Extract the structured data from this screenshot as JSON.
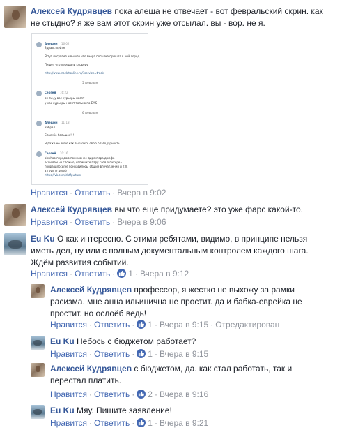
{
  "comments": [
    {
      "author": "Алексей Кудрявцев",
      "text_lines": [
        "пока алеша не отвечает - вот февральский скрин. как",
        "не стыдно? я же вам этот скрин уже отсылал. вы - вор. не я."
      ],
      "like": "Нравится",
      "reply": "Ответить",
      "time": "Вчера в 9:02"
    },
    {
      "author": "Алексей Кудрявцев",
      "text_lines": [
        "вы что еще придумаете? это уже фарс какой-то."
      ],
      "like": "Нравится",
      "reply": "Ответить",
      "time": "Вчера в 9:06"
    },
    {
      "author": "Eu Ku",
      "text_lines": [
        "О как интересно. С этими ребятами, видимо, в принципе нельзя",
        "иметь дел, ну или с полным документальным контролем каждого шага.",
        "Ждём развития событий."
      ],
      "like": "Нравится",
      "reply": "Ответить",
      "likes": "1",
      "time": "Вчера в 9:12"
    },
    {
      "author": "Алексей Кудрявцев",
      "text_lines": [
        "профессор, я жестко не выхожу за рамки",
        "расизма. мне анна ильинична не простит. да и бабка-еврейка не",
        "простит. но ослоёб ведь!"
      ],
      "like": "Нравится",
      "reply": "Ответить",
      "likes": "1",
      "time": "Вчера в 9:15",
      "edited": "Отредактирован"
    },
    {
      "author": "Eu Ku",
      "text_lines": [
        "Небось с бюджетом работает?"
      ],
      "like": "Нравится",
      "reply": "Ответить",
      "likes": "1",
      "time": "Вчера в 9:15"
    },
    {
      "author": "Алексей Кудрявцев",
      "text_lines": [
        "с бюджетом, да. как стал работать, так и",
        "перестал платить."
      ],
      "like": "Нравится",
      "reply": "Ответить",
      "likes": "2",
      "time": "Вчера в 9:16"
    },
    {
      "author": "Eu Ku",
      "text_lines": [
        "Мяу. Пишите заявление!"
      ],
      "like": "Нравится",
      "reply": "Ответить",
      "likes": "1",
      "time": "Вчера в 9:21"
    }
  ],
  "screenshot": {
    "messages": [
      {
        "name": "Алешин",
        "date": "16.02",
        "lines": [
          "Здравствуйте",
          "Я тут погуглил и вышло что вчера посылка пришла в мой город",
          "Пишет что передали курьеру",
          "http://www.trackitonline.ru/?service=track"
        ]
      },
      {
        "sep": "5 февраля"
      },
      {
        "name": "Сергей",
        "date": "16:22",
        "lines": [
          "ох ты, у вас курьеры носят",
          "у нас курьеры носят только по EMS"
        ]
      },
      {
        "sep": "6 февраля"
      },
      {
        "name": "Алешин",
        "date": "11:18",
        "lines": [
          "Забрал",
          "Спасибо большое!!!",
          "Я даже не знаю как выразить свою благодарность"
        ]
      },
      {
        "name": "Сергей",
        "date": "20:16",
        "lines": [
          "alexhob передаю пожелание директора доффа",
          "если вам не сложно, напишите пару слов о питере -",
          "понравилось/не понравилось, общие впечатления и т.п.",
          "в группе дофф",
          "https://vk.com/doffguitars"
        ]
      }
    ]
  },
  "colors": {
    "link": "#4267b2",
    "author": "#365899",
    "meta": "#90949c",
    "text": "#1d2129"
  }
}
